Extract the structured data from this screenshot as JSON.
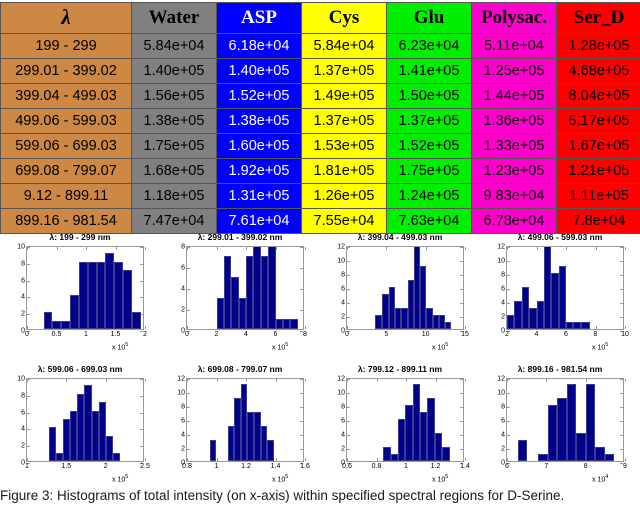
{
  "table": {
    "headers": [
      {
        "label": "λ",
        "key": "lambda",
        "color": "#cc8844",
        "is_symbol": true
      },
      {
        "label": "Water",
        "key": "water",
        "color": "#808080"
      },
      {
        "label": "ASP",
        "key": "asp",
        "color": "#0000ff"
      },
      {
        "label": "Cys",
        "key": "cys",
        "color": "#ffff00"
      },
      {
        "label": "Glu",
        "key": "glu",
        "color": "#00ee00"
      },
      {
        "label": "Polysac.",
        "key": "polysac",
        "color": "#ff00cc"
      },
      {
        "label": "Ser_D",
        "key": "ser_d",
        "color": "#ff0000"
      }
    ],
    "rows": [
      [
        "199 - 299",
        "5.84e+04",
        "6.18e+04",
        "5.84e+04",
        "6.23e+04",
        "5.11e+04",
        "1.28e+05"
      ],
      [
        "299.01 - 399.02",
        "1.40e+05",
        "1.40e+05",
        "1.37e+05",
        "1.41e+05",
        "1.25e+05",
        "4.68e+05"
      ],
      [
        "399.04 - 499.03",
        "1.56e+05",
        "1.52e+05",
        "1.49e+05",
        "1.50e+05",
        "1.44e+05",
        "8.04e+05"
      ],
      [
        "499.06 - 599.03",
        "1.38e+05",
        "1.38e+05",
        "1.37e+05",
        "1.37e+05",
        "1.36e+05",
        "5.17e+05"
      ],
      [
        "599.06 - 699.03",
        "1.75e+05",
        "1.60e+05",
        "1.53e+05",
        "1.52e+05",
        "1.33e+05",
        "1.67e+05"
      ],
      [
        "699.08 - 799.07",
        "1.68e+05",
        "1.92e+05",
        "1.81e+05",
        "1.75e+05",
        "1.23e+05",
        "1.21e+05"
      ],
      [
        "9.12 - 899.11",
        "1.18e+05",
        "1.31e+05",
        "1.26e+05",
        "1.24e+05",
        "9.83e+04",
        "1.11e+05"
      ],
      [
        "899.16 - 981.54",
        "7.47e+04",
        "7.61e+04",
        "7.55e+04",
        "7.63e+04",
        "6.78e+04",
        "7.8e+04"
      ]
    ]
  },
  "caption": "Figure 3: Histograms of total intensity (on x-axis) within specified spectral regions for D-Serine.",
  "chart_data": [
    {
      "type": "bar",
      "title": "λ: 199 - 299 nm",
      "xlabel": "",
      "ylabel": "",
      "exponent": "x 10",
      "exponent_power": "5",
      "xlim": [
        0,
        2
      ],
      "ylim": [
        0,
        10
      ],
      "xticks": [
        0,
        0.5,
        1,
        1.5,
        2
      ],
      "xtick_labels": [
        "0",
        "0.5",
        "1",
        "1.5",
        "2"
      ],
      "yticks": [
        0,
        2,
        4,
        6,
        8,
        10
      ],
      "ytick_labels": [
        "0",
        "2",
        "4",
        "6",
        "8",
        "10"
      ],
      "bin_edges": [
        0.28,
        0.43,
        0.58,
        0.73,
        0.88,
        1.03,
        1.18,
        1.33,
        1.48,
        1.63,
        1.78,
        1.93
      ],
      "values": [
        2,
        1,
        1,
        4,
        8,
        8,
        8,
        9,
        8,
        7,
        2
      ]
    },
    {
      "type": "bar",
      "title": "λ: 299.01 - 399.02 nm",
      "xlabel": "",
      "ylabel": "",
      "exponent": "x 10",
      "exponent_power": "5",
      "xlim": [
        0,
        8
      ],
      "ylim": [
        0,
        8
      ],
      "xticks": [
        0,
        2,
        4,
        6,
        8
      ],
      "xtick_labels": [
        "0",
        "2",
        "4",
        "6",
        "8"
      ],
      "yticks": [
        0,
        2,
        4,
        6,
        8
      ],
      "ytick_labels": [
        "0",
        "2",
        "4",
        "6",
        "8"
      ],
      "bin_edges": [
        2.0,
        2.5,
        3.0,
        3.5,
        4.0,
        4.5,
        5.0,
        5.5,
        6.0,
        6.5,
        7.0,
        7.5
      ],
      "values": [
        3,
        7,
        5,
        3,
        7,
        8,
        7,
        8,
        1,
        1,
        1
      ]
    },
    {
      "type": "bar",
      "title": "λ: 399.04 - 499.03 nm",
      "xlabel": "",
      "ylabel": "",
      "exponent": "x 10",
      "exponent_power": "5",
      "xlim": [
        0,
        15
      ],
      "ylim": [
        0,
        12
      ],
      "xticks": [
        0,
        5,
        10,
        15
      ],
      "xtick_labels": [
        "0",
        "5",
        "10",
        "15"
      ],
      "yticks": [
        0,
        2,
        4,
        6,
        8,
        10,
        12
      ],
      "ytick_labels": [
        "0",
        "2",
        "4",
        "6",
        "8",
        "10",
        "12"
      ],
      "bin_edges": [
        3.6,
        4.5,
        5.3,
        6.1,
        6.9,
        7.7,
        8.5,
        9.3,
        10.1,
        10.9,
        11.7,
        12.5,
        13.2
      ],
      "values": [
        2,
        5,
        6,
        3,
        3,
        7,
        12,
        9,
        3,
        2,
        2,
        1
      ]
    },
    {
      "type": "bar",
      "title": "λ: 499.06 - 599.03 nm",
      "xlabel": "",
      "ylabel": "",
      "exponent": "x 10",
      "exponent_power": "5",
      "xlim": [
        2,
        10
      ],
      "ylim": [
        0,
        12
      ],
      "xticks": [
        2,
        4,
        6,
        8,
        10
      ],
      "xtick_labels": [
        "2",
        "4",
        "6",
        "8",
        "10"
      ],
      "yticks": [
        0,
        2,
        4,
        6,
        8,
        10,
        12
      ],
      "ytick_labels": [
        "0",
        "2",
        "4",
        "6",
        "8",
        "10",
        "12"
      ],
      "bin_edges": [
        2.0,
        2.5,
        3.0,
        3.5,
        4.0,
        4.5,
        5.0,
        5.5,
        6.0,
        6.5,
        7.0,
        7.6,
        8.2
      ],
      "values": [
        2,
        4,
        6,
        3,
        4,
        12,
        8,
        9,
        1,
        1,
        1,
        0
      ]
    },
    {
      "type": "bar",
      "title": "λ: 599.06 - 699.03 nm",
      "xlabel": "",
      "ylabel": "",
      "exponent": "x 10",
      "exponent_power": "5",
      "xlim": [
        1,
        2.5
      ],
      "ylim": [
        0,
        10
      ],
      "xticks": [
        1,
        1.5,
        2,
        2.5
      ],
      "xtick_labels": [
        "1",
        "1.5",
        "2",
        "2.5"
      ],
      "yticks": [
        0,
        2,
        4,
        6,
        8,
        10
      ],
      "ytick_labels": [
        "0",
        "2",
        "4",
        "6",
        "8",
        "10"
      ],
      "bin_edges": [
        1.28,
        1.37,
        1.46,
        1.55,
        1.64,
        1.73,
        1.82,
        1.91,
        2.0,
        2.09,
        2.18
      ],
      "values": [
        4,
        1,
        5,
        6,
        8,
        9,
        6,
        7,
        3,
        1
      ]
    },
    {
      "type": "bar",
      "title": "λ: 699.08 - 799.07 nm",
      "xlabel": "",
      "ylabel": "",
      "exponent": "x 10",
      "exponent_power": "5",
      "xlim": [
        0.8,
        1.6
      ],
      "ylim": [
        0,
        12
      ],
      "xticks": [
        0.8,
        1,
        1.2,
        1.4,
        1.6
      ],
      "xtick_labels": [
        "0.8",
        "1",
        "1.2",
        "1.4",
        "1.6"
      ],
      "yticks": [
        0,
        2,
        4,
        6,
        8,
        10,
        12
      ],
      "ytick_labels": [
        "0",
        "2",
        "4",
        "6",
        "8",
        "10",
        "12"
      ],
      "bin_edges": [
        0.955,
        1.0,
        1.075,
        1.12,
        1.165,
        1.21,
        1.255,
        1.3,
        1.345,
        1.39
      ],
      "values": [
        3,
        0,
        5,
        9,
        11,
        7,
        7,
        5,
        3
      ]
    },
    {
      "type": "bar",
      "title": "λ: 799.12 - 899.11 nm",
      "xlabel": "",
      "ylabel": "",
      "exponent": "x 10",
      "exponent_power": "5",
      "xlim": [
        0.6,
        1.4
      ],
      "ylim": [
        0,
        12
      ],
      "xticks": [
        0.6,
        0.8,
        1,
        1.2,
        1.4
      ],
      "xtick_labels": [
        "0.6",
        "0.8",
        "1",
        "1.2",
        "1.4"
      ],
      "yticks": [
        0,
        2,
        4,
        6,
        8,
        10,
        12
      ],
      "ytick_labels": [
        "0",
        "2",
        "4",
        "6",
        "8",
        "10",
        "12"
      ],
      "bin_edges": [
        0.845,
        0.895,
        0.945,
        0.995,
        1.045,
        1.095,
        1.145,
        1.195,
        1.245,
        1.295
      ],
      "values": [
        2,
        1,
        6,
        8,
        11,
        7,
        9,
        4,
        2
      ]
    },
    {
      "type": "bar",
      "title": "λ: 899.16 - 981.54 nm",
      "xlabel": "",
      "ylabel": "",
      "exponent": "x 10",
      "exponent_power": "4",
      "xlim": [
        6,
        9
      ],
      "ylim": [
        0,
        12
      ],
      "xticks": [
        6,
        7,
        8,
        9
      ],
      "xtick_labels": [
        "6",
        "7",
        "8",
        "9"
      ],
      "yticks": [
        0,
        2,
        4,
        6,
        8,
        10,
        12
      ],
      "ytick_labels": [
        "0",
        "2",
        "4",
        "6",
        "8",
        "10",
        "12"
      ],
      "bin_edges": [
        6.28,
        6.52,
        6.8,
        7.04,
        7.28,
        7.52,
        7.76,
        8.0,
        8.24,
        8.48,
        8.72
      ],
      "values": [
        3,
        0,
        1,
        8,
        9,
        11,
        4,
        11,
        2,
        1
      ]
    }
  ]
}
